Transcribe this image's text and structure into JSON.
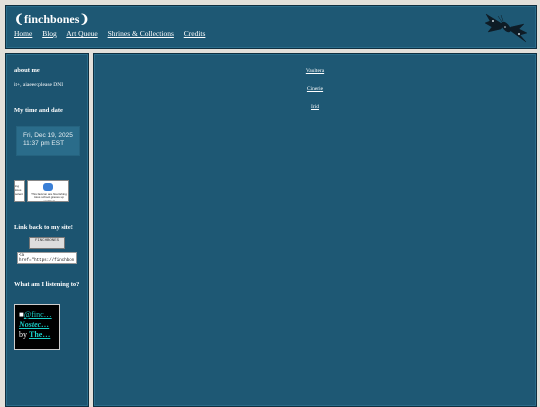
{
  "header": {
    "title": "❨finchbones❩",
    "nav": [
      "Home",
      "Blog",
      "Art Queue",
      "Shrines & Collections",
      "Credits"
    ]
  },
  "sidebar": {
    "about_heading": "about me",
    "about_text": "it+, aiaeee:please DNI",
    "time_heading": "My time and date",
    "date": "Fri, Dec 19, 2025",
    "time": "11:37 pm EST",
    "blinkie_a_text": "ing lotus solent",
    "blinkie_b_text": "This favicon are flourishing lotus school graces up updated",
    "linkback_heading": "Link back to my site!",
    "linkback_button_text": "FINCHBONES",
    "linkback_code": "<a href=\"https://finchbon",
    "music_heading": "What am I listening to?",
    "music_user": "@finc…",
    "music_track": "Nostec…",
    "music_by": "by",
    "music_artist": "The…"
  },
  "main": {
    "links": [
      "Vaultera",
      "Cinerie",
      "Irid"
    ]
  },
  "colors": {
    "panel": "#1e5874",
    "background": "#e3e0da",
    "link_accent": "#1ad0c8"
  }
}
